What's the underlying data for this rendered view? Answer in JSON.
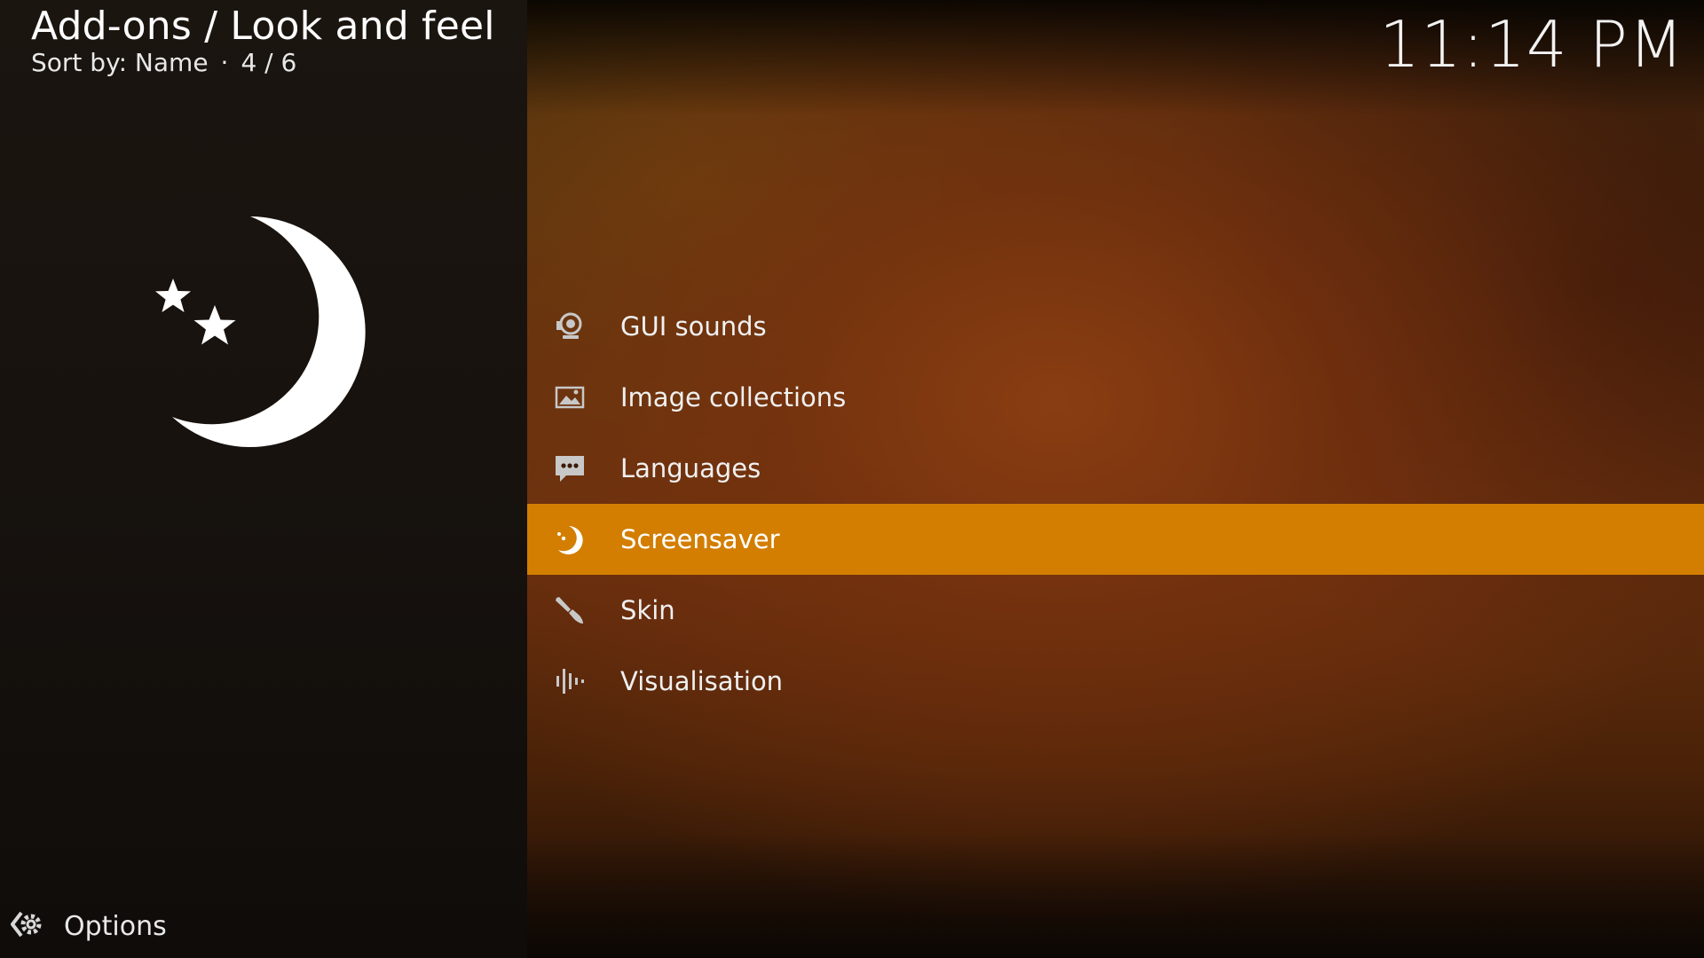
{
  "header": {
    "title": "Add-ons / Look and feel",
    "sort_label": "Sort by: Name",
    "separator": "·",
    "position": "4 / 6"
  },
  "clock": "11:14 PM",
  "preview": {
    "icon": "moon-stars-icon"
  },
  "list": {
    "items": [
      {
        "label": "GUI sounds",
        "icon": "speaker-icon",
        "selected": false
      },
      {
        "label": "Image collections",
        "icon": "image-icon",
        "selected": false
      },
      {
        "label": "Languages",
        "icon": "chat-bubble-icon",
        "selected": false
      },
      {
        "label": "Screensaver",
        "icon": "moon-icon",
        "selected": true
      },
      {
        "label": "Skin",
        "icon": "brush-icon",
        "selected": false
      },
      {
        "label": "Visualisation",
        "icon": "audio-bars-icon",
        "selected": false
      }
    ]
  },
  "footer": {
    "options_label": "Options",
    "icon": "options-gear-icon"
  },
  "colors": {
    "accent": "#d37e00",
    "left_panel": "#17120e",
    "background_warm": "#6a300f",
    "icon_gray": "#c8c8c8"
  }
}
